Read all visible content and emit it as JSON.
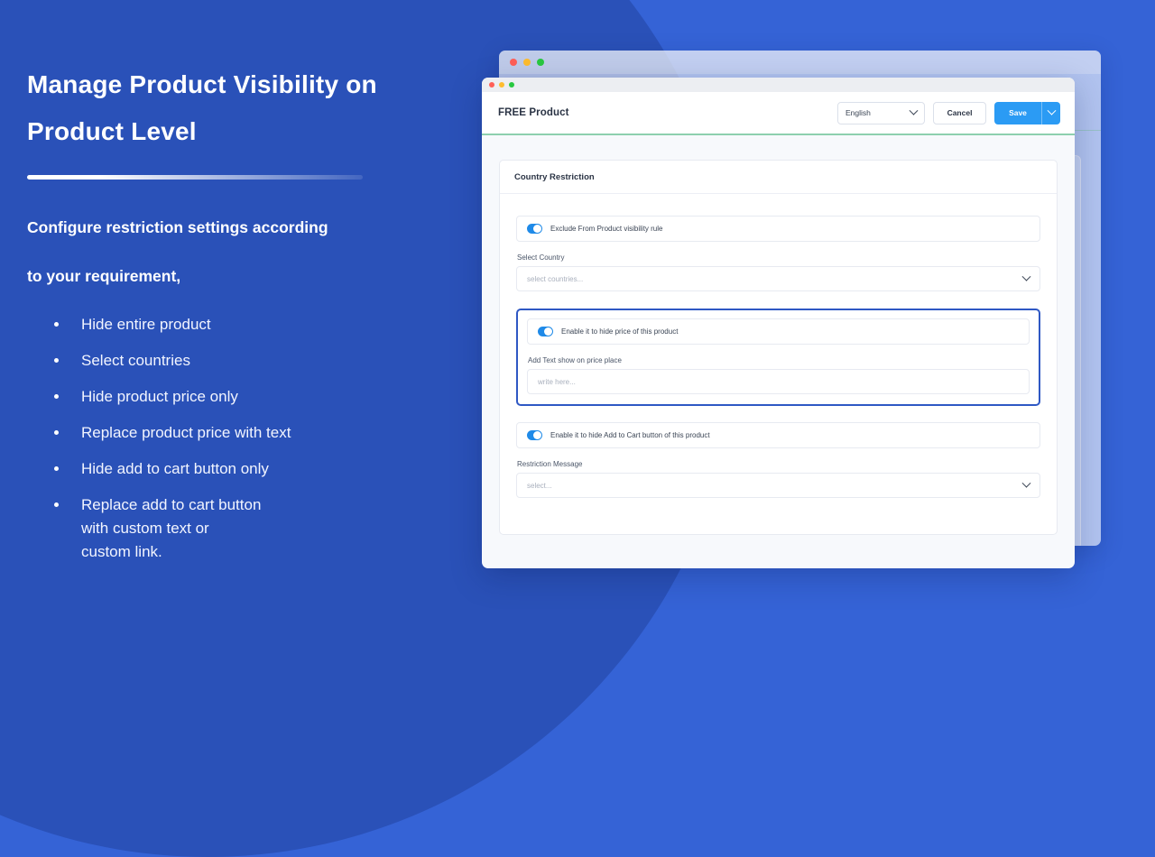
{
  "theme": {
    "bg_blue": "#3563d6",
    "circle_blue": "#2a51b8",
    "accent_blue": "#2b9bf4",
    "toggle_blue": "#1f8ae8",
    "highlight_border": "#2f58c4",
    "header_rule_green": "#8dd0ae"
  },
  "left_panel": {
    "headline_line1": "Manage Product Visibility on",
    "headline_line2": "Product Level",
    "subhead_line1": "Configure restriction settings according",
    "subhead_line2": "to your requirement,",
    "features": [
      {
        "lines": [
          "Hide entire product"
        ]
      },
      {
        "lines": [
          "Select countries"
        ]
      },
      {
        "lines": [
          "Hide product price only"
        ]
      },
      {
        "lines": [
          "Replace product price with text"
        ]
      },
      {
        "lines": [
          "Hide add to cart button only"
        ]
      },
      {
        "lines": [
          "Replace add to cart button",
          "with custom text or",
          "custom link."
        ]
      }
    ]
  },
  "modal": {
    "title": "FREE Product",
    "language_select": {
      "value": "English",
      "icon": "chevron-down-icon"
    },
    "cancel_label": "Cancel",
    "save_label": "Save",
    "save_caret_icon": "chevron-down-icon",
    "card": {
      "header": "Country Restriction",
      "exclude_toggle": {
        "label": "Exclude From Product visibility rule",
        "state": "on"
      },
      "select_country": {
        "label": "Select Country",
        "placeholder": "select countries...",
        "icon": "chevron-down-icon"
      },
      "hide_price_group": {
        "toggle_label": "Enable it to hide price of this product",
        "toggle_state": "on",
        "text_label": "Add Text show on price place",
        "text_placeholder": "write here..."
      },
      "hide_cart_toggle": {
        "label": "Enable it to hide Add to Cart button of this product",
        "state": "on"
      },
      "restriction_message": {
        "label": "Restriction Message",
        "placeholder": "select...",
        "icon": "chevron-down-icon"
      }
    }
  },
  "window_dots": [
    "red",
    "yellow",
    "green"
  ]
}
